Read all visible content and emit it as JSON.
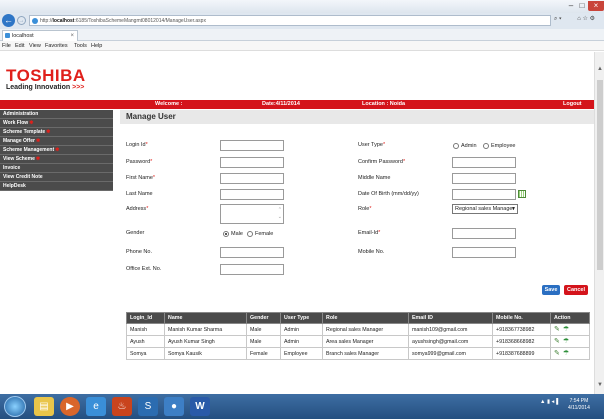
{
  "browser": {
    "url_prefix": "http://",
    "url_host": "localhost",
    "url_rest": ":6185/ToshibaSchemeMangmt08012014/ManageUser.aspx",
    "search_label": "⌕ ▾",
    "tab_title": "localhost",
    "tab_close": "×",
    "menu": [
      "File",
      "Edit",
      "View",
      "Favorites",
      "Tools",
      "Help"
    ],
    "home_star_gear": "⌂ ☆ ⚙"
  },
  "header": {
    "logo": "TOSHIBA",
    "tagline": "Leading Innovation",
    "tagline_arrows": ">>>"
  },
  "topbar": {
    "welcome": "Welcome :",
    "date": "Date:4/11/2014",
    "location": "Location : Noida",
    "logout": "Logout"
  },
  "sidebar": {
    "items": [
      {
        "label": "Administration",
        "star": false
      },
      {
        "label": "Work Flow",
        "star": true
      },
      {
        "label": "Scheme Template",
        "star": true
      },
      {
        "label": "Manage Offer",
        "star": true
      },
      {
        "label": "Scheme Management",
        "star": true
      },
      {
        "label": "View Scheme",
        "star": true
      },
      {
        "label": "Invoice",
        "star": false
      },
      {
        "label": "View Credit Note",
        "star": false
      },
      {
        "label": "HelpDesk",
        "star": false
      }
    ],
    "star_char": "✱"
  },
  "form": {
    "title": "Manage User",
    "req": "*",
    "login_id": "Login Id",
    "user_type": "User Type",
    "admin": "Admin",
    "employee": "Employee",
    "password": "Password",
    "confirm_password": "Confirm Password",
    "first_name": "First Name",
    "middle_name": "Middle Name",
    "last_name": "Last Name",
    "dob": "Date Of Birth (mm/dd/yy)",
    "address": "Address",
    "role": "Role",
    "role_value": "Regional sales Manager",
    "gender": "Gender",
    "male": "Male",
    "female": "Female",
    "email": "Email-Id",
    "phone": "Phone No.",
    "mobile": "Mobile No.",
    "office_ext": "Office Ext. No.",
    "save": "Save",
    "cancel": "Cancel",
    "selected_gender": "Male"
  },
  "table": {
    "headers": [
      "Login_Id",
      "Name",
      "Gender",
      "User Type",
      "Role",
      "Email ID",
      "Mobile No.",
      "Action"
    ],
    "rows": [
      [
        "Manish",
        "Manish Kumar Sharma",
        "Male",
        "Admin",
        "Regional sales Manager",
        "manish109@gmail.com",
        "+918367738982"
      ],
      [
        "Ayush",
        "Ayush Kumar Singh",
        "Male",
        "Admin",
        "Area sales Manager",
        "ayushsingh@gmail.com",
        "+918368668982"
      ],
      [
        "Somya",
        "Somya Kausik",
        "Female",
        "Employee",
        "Branch sales Manager",
        "somya999@gmail.com",
        "+918387688899"
      ]
    ],
    "edit_icon": "✎",
    "delete_icon": "☂"
  },
  "taskbar": {
    "tray": "▲ ▮ ◂▐",
    "time": "7:54 PM",
    "date": "4/11/2014"
  },
  "colors": {
    "brand_red": "#d4141b",
    "save_blue": "#2a6fc2",
    "sidebar_gray": "#4b4b4b"
  }
}
